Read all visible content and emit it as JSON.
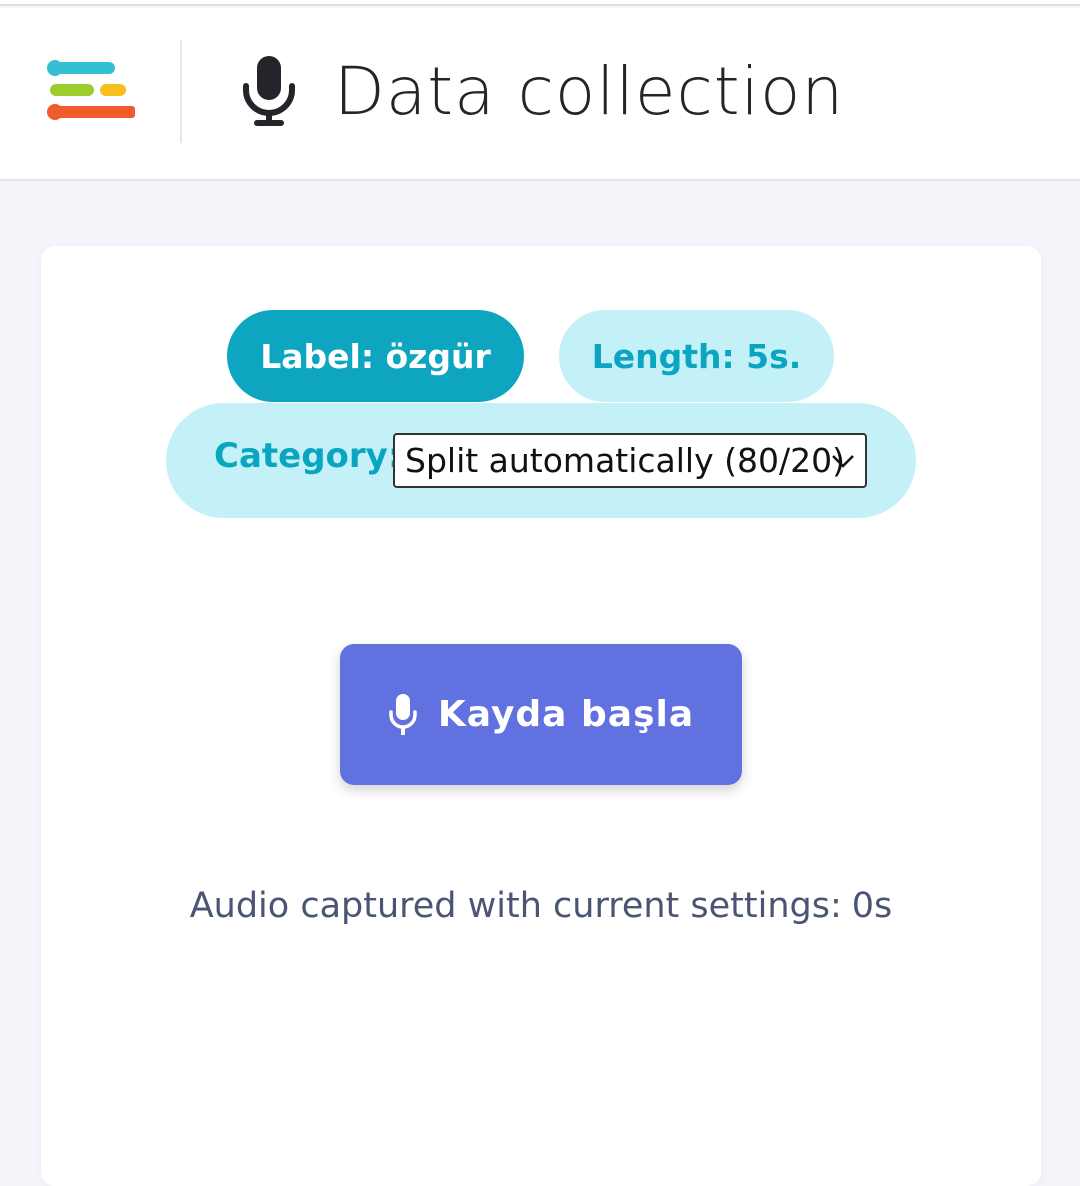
{
  "header": {
    "title": "Data collection",
    "logo_icon": "edge-impulse-logo",
    "title_icon": "microphone-icon"
  },
  "recording": {
    "label_text": "Label: özgür",
    "length_text": "Length: 5s.",
    "category_label": "Category:",
    "category_selected": "Split automatically (80/20)",
    "record_button_label": "Kayda başla",
    "captured_label": "Audio captured with current settings:",
    "captured_value": "0s"
  },
  "colors": {
    "accent_teal": "#0ea5c0",
    "pill_light": "#c4f1f8",
    "record_button": "#6172e0",
    "page_background": "#f4f5fa"
  }
}
